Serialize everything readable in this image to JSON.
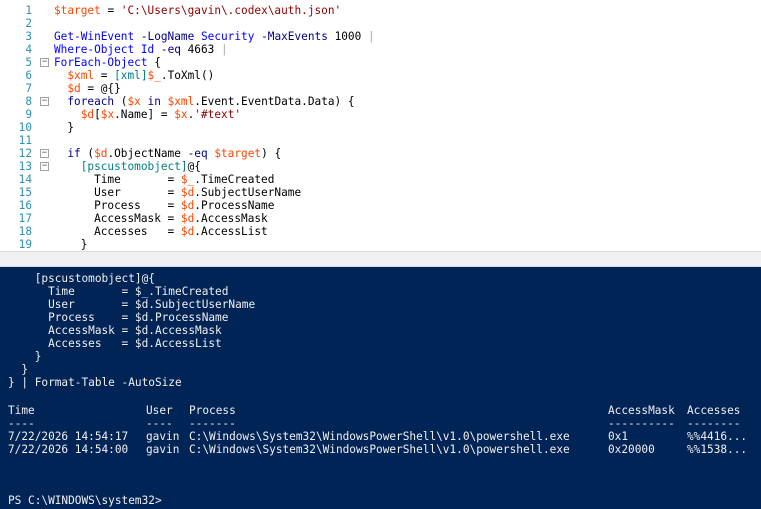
{
  "editor": {
    "lines": [
      {
        "n": "1",
        "fold": "",
        "indent": "",
        "tokens": [
          [
            "var",
            "$target"
          ],
          [
            "plain",
            " = "
          ],
          [
            "str",
            "'C:\\Users\\gavin\\.codex\\auth.json'"
          ]
        ]
      },
      {
        "n": "2",
        "fold": "",
        "indent": "",
        "tokens": []
      },
      {
        "n": "3",
        "fold": "",
        "indent": "",
        "tokens": [
          [
            "cmd",
            "Get-WinEvent"
          ],
          [
            "plain",
            " "
          ],
          [
            "param",
            "-LogName"
          ],
          [
            "plain",
            " "
          ],
          [
            "cmd",
            "Security"
          ],
          [
            "plain",
            " "
          ],
          [
            "param",
            "-MaxEvents"
          ],
          [
            "plain",
            " 1000 "
          ],
          [
            "op",
            "|"
          ]
        ]
      },
      {
        "n": "4",
        "fold": "",
        "indent": "",
        "tokens": [
          [
            "cmd",
            "Where-Object"
          ],
          [
            "plain",
            " "
          ],
          [
            "cmd",
            "Id"
          ],
          [
            "plain",
            " "
          ],
          [
            "param",
            "-eq"
          ],
          [
            "plain",
            " 4663 "
          ],
          [
            "op",
            "|"
          ]
        ]
      },
      {
        "n": "5",
        "fold": "−",
        "indent": "",
        "tokens": [
          [
            "cmd",
            "ForEach-Object"
          ],
          [
            "plain",
            " {"
          ]
        ]
      },
      {
        "n": "6",
        "fold": "",
        "indent": "  ",
        "tokens": [
          [
            "var",
            "$xml"
          ],
          [
            "plain",
            " = "
          ],
          [
            "type",
            "[xml]"
          ],
          [
            "var",
            "$_"
          ],
          [
            "plain",
            ".ToXml()"
          ]
        ]
      },
      {
        "n": "7",
        "fold": "",
        "indent": "  ",
        "tokens": [
          [
            "var",
            "$d"
          ],
          [
            "plain",
            " = @{}"
          ]
        ]
      },
      {
        "n": "8",
        "fold": "−",
        "indent": "  ",
        "tokens": [
          [
            "kw",
            "foreach"
          ],
          [
            "plain",
            " ("
          ],
          [
            "var",
            "$x"
          ],
          [
            "plain",
            " "
          ],
          [
            "kw",
            "in"
          ],
          [
            "plain",
            " "
          ],
          [
            "var",
            "$xml"
          ],
          [
            "plain",
            ".Event.EventData.Data) {"
          ]
        ]
      },
      {
        "n": "9",
        "fold": "",
        "indent": "    ",
        "tokens": [
          [
            "var",
            "$d"
          ],
          [
            "plain",
            "["
          ],
          [
            "var",
            "$x"
          ],
          [
            "plain",
            ".Name] = "
          ],
          [
            "var",
            "$x"
          ],
          [
            "plain",
            "."
          ],
          [
            "str",
            "'#text'"
          ]
        ]
      },
      {
        "n": "10",
        "fold": "",
        "indent": "  ",
        "tokens": [
          [
            "plain",
            "}"
          ]
        ]
      },
      {
        "n": "11",
        "fold": "",
        "indent": "",
        "tokens": []
      },
      {
        "n": "12",
        "fold": "−",
        "indent": "  ",
        "tokens": [
          [
            "kw",
            "if"
          ],
          [
            "plain",
            " ("
          ],
          [
            "var",
            "$d"
          ],
          [
            "plain",
            ".ObjectName "
          ],
          [
            "param",
            "-eq"
          ],
          [
            "plain",
            " "
          ],
          [
            "var",
            "$target"
          ],
          [
            "plain",
            ") {"
          ]
        ]
      },
      {
        "n": "13",
        "fold": "−",
        "indent": "    ",
        "tokens": [
          [
            "type",
            "[pscustomobject]"
          ],
          [
            "plain",
            "@{"
          ]
        ]
      },
      {
        "n": "14",
        "fold": "",
        "indent": "      ",
        "tokens": [
          [
            "plain",
            "Time       = "
          ],
          [
            "var",
            "$_"
          ],
          [
            "plain",
            ".TimeCreated"
          ]
        ]
      },
      {
        "n": "15",
        "fold": "",
        "indent": "      ",
        "tokens": [
          [
            "plain",
            "User       = "
          ],
          [
            "var",
            "$d"
          ],
          [
            "plain",
            ".SubjectUserName"
          ]
        ]
      },
      {
        "n": "16",
        "fold": "",
        "indent": "      ",
        "tokens": [
          [
            "plain",
            "Process    = "
          ],
          [
            "var",
            "$d"
          ],
          [
            "plain",
            ".ProcessName"
          ]
        ]
      },
      {
        "n": "17",
        "fold": "",
        "indent": "      ",
        "tokens": [
          [
            "plain",
            "AccessMask = "
          ],
          [
            "var",
            "$d"
          ],
          [
            "plain",
            ".AccessMask"
          ]
        ]
      },
      {
        "n": "18",
        "fold": "",
        "indent": "      ",
        "tokens": [
          [
            "plain",
            "Accesses   = "
          ],
          [
            "var",
            "$d"
          ],
          [
            "plain",
            ".AccessList"
          ]
        ]
      },
      {
        "n": "19",
        "fold": "",
        "indent": "    ",
        "tokens": [
          [
            "plain",
            "}"
          ]
        ]
      }
    ]
  },
  "console": {
    "echo": [
      "    [pscustomobject]@{",
      "      Time       = $_.TimeCreated",
      "      User       = $d.SubjectUserName",
      "      Process    = $d.ProcessName",
      "      AccessMask = $d.AccessMask",
      "      Accesses   = $d.AccessList",
      "    }",
      "  }",
      "} | Format-Table -AutoSize"
    ],
    "table": {
      "columns": [
        "Time",
        "User",
        "Process",
        "AccessMask",
        "Accesses"
      ],
      "underline": [
        "----",
        "----",
        "-------",
        "----------",
        "--------"
      ],
      "rows": [
        [
          "7/22/2026 14:54:17",
          "gavin",
          "C:\\Windows\\System32\\WindowsPowerShell\\v1.0\\powershell.exe",
          "0x1",
          "%%4416..."
        ],
        [
          "7/22/2026 14:54:00",
          "gavin",
          "C:\\Windows\\System32\\WindowsPowerShell\\v1.0\\powershell.exe",
          "0x20000",
          "%%1538..."
        ]
      ]
    },
    "prompt": "PS C:\\WINDOWS\\system32>"
  }
}
